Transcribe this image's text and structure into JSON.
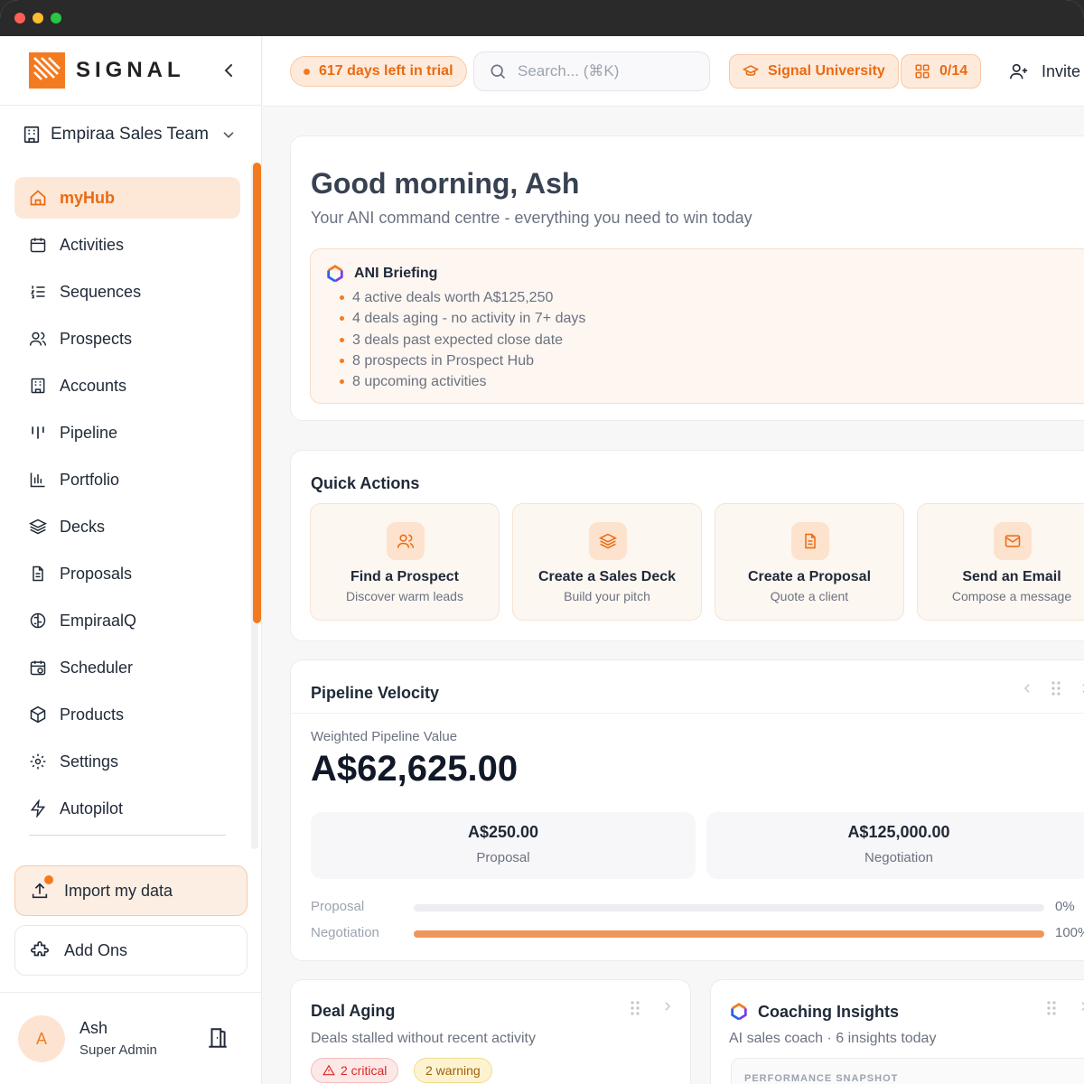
{
  "app": {
    "brand": "SIGNAL"
  },
  "sidebar": {
    "team": "Empiraa Sales Team",
    "items": [
      {
        "label": "myHub",
        "icon": "home-icon",
        "active": true
      },
      {
        "label": "Activities",
        "icon": "calendar-icon"
      },
      {
        "label": "Sequences",
        "icon": "list-ordered-icon"
      },
      {
        "label": "Prospects",
        "icon": "users-icon"
      },
      {
        "label": "Accounts",
        "icon": "building-icon"
      },
      {
        "label": "Pipeline",
        "icon": "pipeline-icon"
      },
      {
        "label": "Portfolio",
        "icon": "bar-chart-icon"
      },
      {
        "label": "Decks",
        "icon": "layers-icon"
      },
      {
        "label": "Proposals",
        "icon": "file-text-icon"
      },
      {
        "label": "EmpiraalQ",
        "icon": "brain-icon"
      },
      {
        "label": "Scheduler",
        "icon": "calendar-clock-icon"
      },
      {
        "label": "Products",
        "icon": "package-icon"
      },
      {
        "label": "Settings",
        "icon": "gear-icon"
      },
      {
        "label": "Autopilot",
        "icon": "zap-icon"
      }
    ],
    "import_label": "Import my data",
    "addons_label": "Add Ons",
    "user": {
      "initial": "A",
      "name": "Ash",
      "role": "Super Admin"
    }
  },
  "topbar": {
    "trial": "617 days left in trial",
    "search_placeholder": "Search... (⌘K)",
    "university": "Signal University",
    "progress": "0/14",
    "invite": "Invite"
  },
  "greeting": {
    "title": "Good morning, Ash",
    "subtitle": "Your ANI command centre - everything you need to win today",
    "briefing_title": "ANI Briefing",
    "briefing": [
      "4 active deals worth A$125,250",
      "4 deals aging - no activity in 7+ days",
      "3 deals past expected close date",
      "8 prospects in Prospect Hub",
      "8 upcoming activities"
    ]
  },
  "quick_actions": {
    "title": "Quick Actions",
    "items": [
      {
        "title": "Find a Prospect",
        "subtitle": "Discover warm leads",
        "icon": "users-icon"
      },
      {
        "title": "Create a Sales Deck",
        "subtitle": "Build your pitch",
        "icon": "layers-icon"
      },
      {
        "title": "Create a Proposal",
        "subtitle": "Quote a client",
        "icon": "file-text-icon"
      },
      {
        "title": "Send an Email",
        "subtitle": "Compose a message",
        "icon": "mail-icon"
      }
    ]
  },
  "pipeline_velocity": {
    "title": "Pipeline Velocity",
    "weighted_label": "Weighted Pipeline Value",
    "weighted_value": "A$62,625.00",
    "stages": [
      {
        "value": "A$250.00",
        "label": "Proposal"
      },
      {
        "value": "A$125,000.00",
        "label": "Negotiation"
      }
    ],
    "bars": [
      {
        "label": "Proposal",
        "percent": 0,
        "percent_label": "0%"
      },
      {
        "label": "Negotiation",
        "percent": 100,
        "percent_label": "100%"
      }
    ]
  },
  "deal_aging": {
    "title": "Deal Aging",
    "subtitle": "Deals stalled without recent activity",
    "critical": "2 critical",
    "warning": "2 warning"
  },
  "coaching": {
    "title": "Coaching Insights",
    "subtitle": "AI sales coach · 6 insights today",
    "snapshot": "PERFORMANCE SNAPSHOT"
  },
  "colors": {
    "accent": "#f47a20",
    "accent_bg": "#fde8d8",
    "bar_fill": "#f0955a"
  }
}
